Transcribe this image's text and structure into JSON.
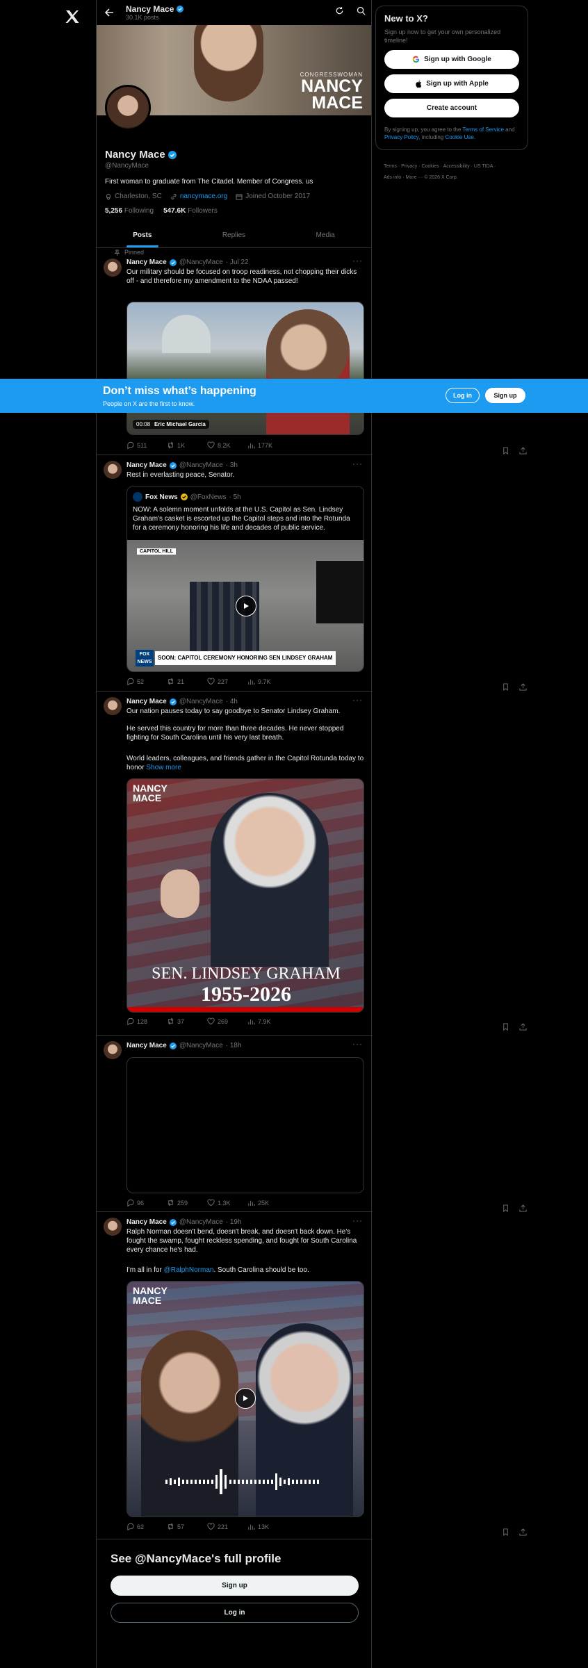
{
  "app": {
    "logo": "x-logo-icon"
  },
  "header": {
    "name": "Nancy Mace",
    "posts": "30.1K posts"
  },
  "banner": {
    "small": "CONGRESSWOMAN",
    "big1": "NANCY",
    "big2": "MACE"
  },
  "profile": {
    "name": "Nancy Mace",
    "handle": "@NancyMace",
    "bio": "First woman to graduate from The Citadel. Member of Congress. us",
    "location": "Charleston, SC",
    "website": "nancymace.org",
    "joined": "Joined October 2017",
    "following_count": "5,256",
    "following_label": "Following",
    "followers_count": "547.6K",
    "followers_label": "Followers"
  },
  "tabs": [
    {
      "label": "Posts"
    },
    {
      "label": "Replies"
    },
    {
      "label": "Media"
    }
  ],
  "posts": [
    {
      "pinned": "Pinned",
      "name": "Nancy Mace",
      "handle": "@NancyMace",
      "time": "· Jul 22",
      "text": "Our military should be focused on troop readiness, not chopping their dicks off - and therefore my amendment to the NDAA passed!",
      "video_time": "00:08",
      "video_credit": "Eric Michael Garcia",
      "replies": "511",
      "reposts": "1K",
      "likes": "8.2K",
      "views": "177K"
    },
    {
      "name": "Nancy Mace",
      "handle": "@NancyMace",
      "time": "· 3h",
      "text": "Rest in everlasting peace, Senator.",
      "quote": {
        "name": "Fox News",
        "handle": "@FoxNews",
        "time": "· 5h",
        "text": "NOW: A solemn moment unfolds at the U.S. Capitol as Sen. Lindsey Graham's casket is escorted up the Capitol steps and into the Rotunda for a ceremony honoring his life and decades of public service.",
        "chyron_tag": "CAPITOL HILL",
        "chyron": "SOON: CAPITOL CEREMONY HONORING SEN LINDSEY GRAHAM",
        "logo": "FOX NEWS"
      },
      "replies": "52",
      "reposts": "21",
      "likes": "227",
      "views": "9.7K"
    },
    {
      "name": "Nancy Mace",
      "handle": "@NancyMace",
      "time": "· 4h",
      "p1": "Our nation pauses today to say goodbye to Senator Lindsey Graham.",
      "p2": "He served this country for more than three decades. He never stopped fighting for South Carolina until his very last breath.",
      "p3": "World leaders, colleagues, and friends gather in the Capitol Rotunda today to honor",
      "show_more": "Show more",
      "img_brand": "NANCY MACE",
      "img_title": "SEN. LINDSEY GRAHAM",
      "img_years": "1955-2026",
      "replies": "128",
      "reposts": "37",
      "likes": "269",
      "views": "7.9K"
    },
    {
      "name": "Nancy Mace",
      "handle": "@NancyMace",
      "time": "· 18h",
      "replies": "96",
      "reposts": "259",
      "likes": "1.3K",
      "views": "25K"
    },
    {
      "name": "Nancy Mace",
      "handle": "@NancyMace",
      "time": "· 19h",
      "p1": "Ralph Norman doesn't bend, doesn't break, and doesn't back down. He's fought the swamp, fought reckless spending, and fought for South Carolina every chance he's had.",
      "p2a": "I'm all in for ",
      "p2link": "@RalphNorman",
      "p2b": ". South Carolina should be too.",
      "img_brand": "NANCY MACE",
      "replies": "62",
      "reposts": "57",
      "likes": "221",
      "views": "13K"
    }
  ],
  "see_profile": {
    "title": "See @NancyMace's full profile",
    "signup": "Sign up",
    "login": "Log in"
  },
  "sidebar": {
    "title": "New to X?",
    "subtitle": "Sign up now to get your own personalized timeline!",
    "google": "Sign up with Google",
    "apple": "Sign up with Apple",
    "create": "Create account",
    "terms_a": "By signing up, you agree to the ",
    "terms_tos": "Terms of Service",
    "terms_b": " and ",
    "terms_pp": "Privacy Policy",
    "terms_c": ", including ",
    "terms_cu": "Cookie Use",
    "terms_d": ".",
    "footer1": "Terms · Privacy · Cookies · Accessibility · US TIDA ·",
    "footer2": "Ads info · More ··· © 2026 X Corp."
  },
  "bottom_bar": {
    "title": "Don’t miss what’s happening",
    "subtitle": "People on X are the first to know.",
    "login": "Log in",
    "signup": "Sign up"
  }
}
